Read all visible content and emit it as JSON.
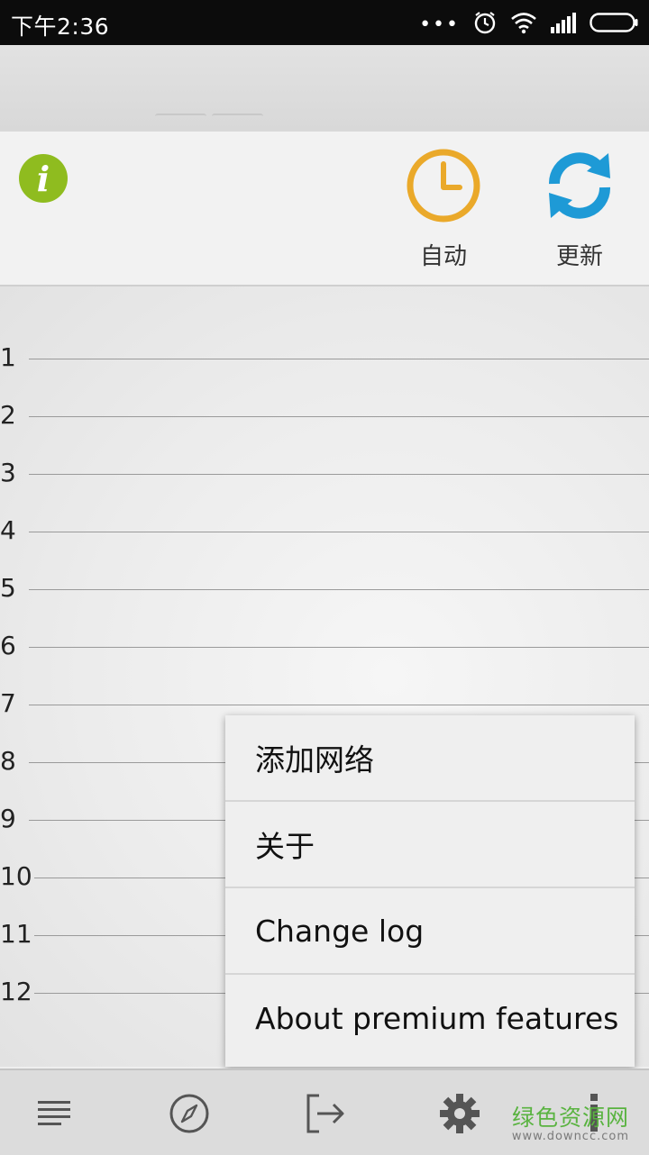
{
  "status": {
    "time": "下午2:36"
  },
  "toolbar": {
    "auto_label": "自动",
    "update_label": "更新"
  },
  "rows": [
    "1",
    "2",
    "3",
    "4",
    "5",
    "6",
    "7",
    "8",
    "9",
    "10",
    "11",
    "12"
  ],
  "menu": {
    "items": [
      "添加网络",
      "关于",
      "Change log",
      "About premium features"
    ]
  },
  "watermark": {
    "main": "绿色资源网",
    "url": "www.downcc.com"
  },
  "colors": {
    "info": "#8fbc1f",
    "clock": "#eaa92a",
    "refresh": "#1e9ad6"
  }
}
